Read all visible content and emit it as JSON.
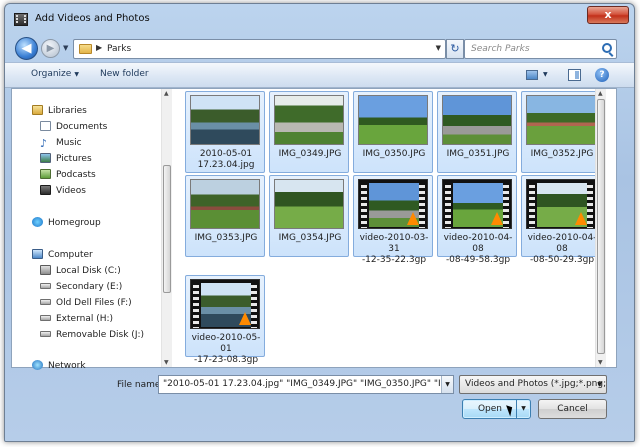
{
  "window": {
    "title": "Add Videos and Photos",
    "close_label": "x"
  },
  "nav": {
    "address": "Parks",
    "search_placeholder": "Search Parks"
  },
  "toolbar": {
    "organize_label": "Organize",
    "new_folder_label": "New folder",
    "help_label": "?"
  },
  "sidebar": {
    "libraries": "Libraries",
    "documents": "Documents",
    "music": "Music",
    "pictures": "Pictures",
    "podcasts": "Podcasts",
    "videos": "Videos",
    "homegroup": "Homegroup",
    "computer": "Computer",
    "local_disk": "Local Disk (C:)",
    "secondary": "Secondary (E:)",
    "old_dell": "Old Dell Files (F:)",
    "external": "External (H:)",
    "removable": "Removable Disk (J:)",
    "network": "Network"
  },
  "files": [
    {
      "name_line1": "2010-05-01",
      "name_line2": "17.23.04.jpg"
    },
    {
      "name_line1": "IMG_0349.JPG",
      "name_line2": ""
    },
    {
      "name_line1": "IMG_0350.JPG",
      "name_line2": ""
    },
    {
      "name_line1": "IMG_0351.JPG",
      "name_line2": ""
    },
    {
      "name_line1": "IMG_0352.JPG",
      "name_line2": ""
    },
    {
      "name_line1": "IMG_0353.JPG",
      "name_line2": ""
    },
    {
      "name_line1": "IMG_0354.JPG",
      "name_line2": ""
    },
    {
      "name_line1": "video-2010-03-31",
      "name_line2": "-12-35-22.3gp"
    },
    {
      "name_line1": "video-2010-04-08",
      "name_line2": "-08-49-58.3gp"
    },
    {
      "name_line1": "video-2010-04-08",
      "name_line2": "-08-50-29.3gp"
    },
    {
      "name_line1": "video-2010-05-01",
      "name_line2": "-17-23-08.3gp"
    }
  ],
  "bottom": {
    "filename_label": "File name:",
    "filename_value": "\"2010-05-01 17.23.04.jpg\" \"IMG_0349.JPG\" \"IMG_0350.JPG\" \"IMG_035",
    "filetype_value": "Videos and Photos (*.jpg;*.png;",
    "open_label": "Open",
    "cancel_label": "Cancel"
  }
}
